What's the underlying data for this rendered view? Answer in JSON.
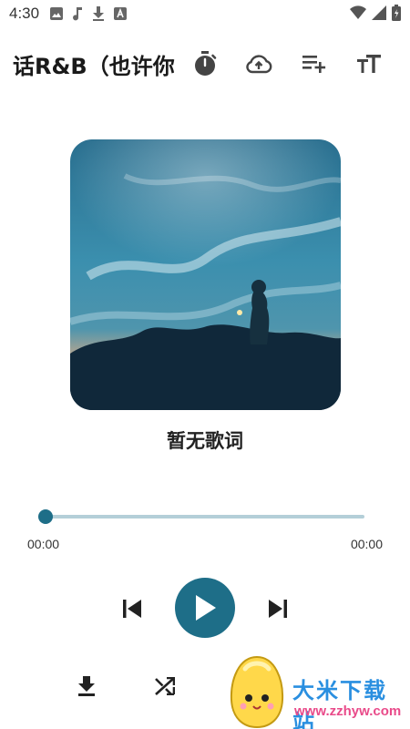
{
  "status_bar": {
    "time": "4:30",
    "left_icons": [
      "image-icon",
      "music-note-icon",
      "download-icon",
      "a-icon"
    ],
    "right_icons": [
      "wifi-icon",
      "signal-icon",
      "battery-icon"
    ]
  },
  "app_bar": {
    "title": "话R&B（也许你",
    "actions": [
      "timer-icon",
      "cloud-upload-icon",
      "playlist-add-icon",
      "text-size-icon"
    ]
  },
  "lyrics": {
    "text": "暂无歌词"
  },
  "player": {
    "current_time": "00:00",
    "total_time": "00:00",
    "progress": 0.0
  },
  "controls": [
    "skip-previous-icon",
    "play-icon",
    "skip-next-icon"
  ],
  "secondary_controls": [
    "download-icon",
    "shuffle-icon"
  ],
  "watermark": {
    "title": "大米下载站",
    "url": "www.zzhyw.com"
  },
  "colors": {
    "accent": "#1e6e88",
    "track": "#b4cfd8"
  }
}
